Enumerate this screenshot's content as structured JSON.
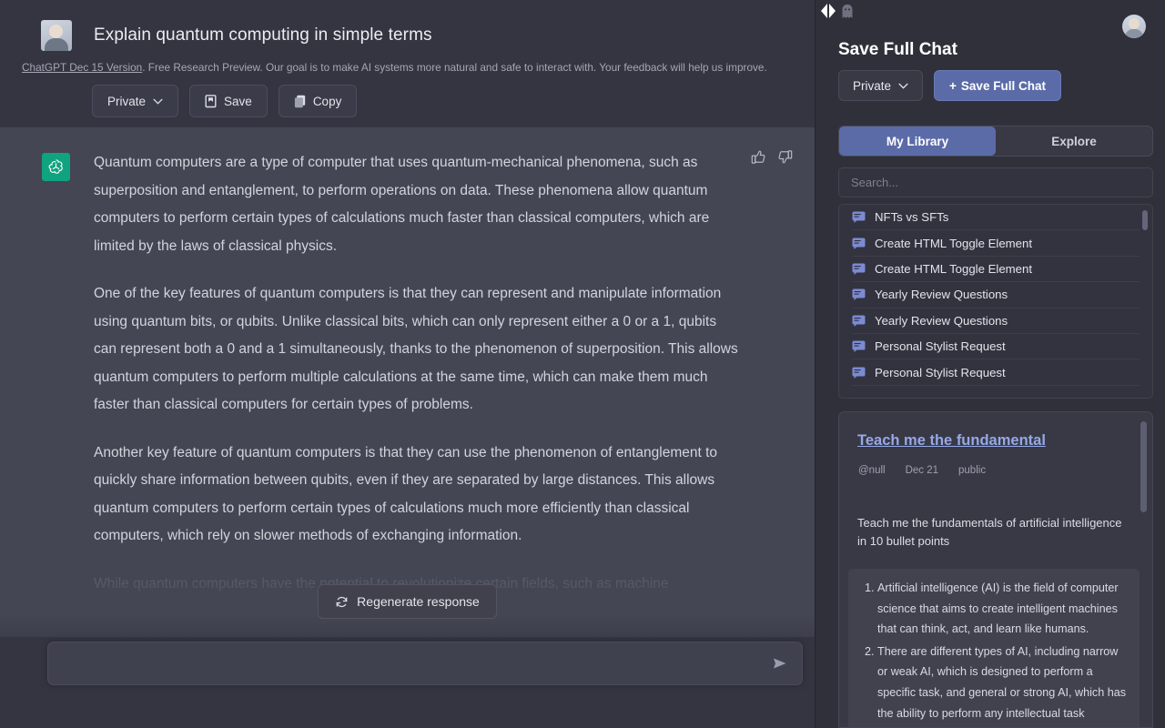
{
  "chat": {
    "prompt_title": "Explain quantum computing in simple terms",
    "actions": {
      "privacy_label": "Private",
      "save_label": "Save",
      "copy_label": "Copy"
    },
    "response_paragraphs": [
      "Quantum computers are a type of computer that uses quantum-mechanical phenomena, such as superposition and entanglement, to perform operations on data. These phenomena allow quantum computers to perform certain types of calculations much faster than classical computers, which are limited by the laws of classical physics.",
      "One of the key features of quantum computers is that they can represent and manipulate information using quantum bits, or qubits. Unlike classical bits, which can only represent either a 0 or a 1, qubits can represent both a 0 and a 1 simultaneously, thanks to the phenomenon of superposition. This allows quantum computers to perform multiple calculations at the same time, which can make them much faster than classical computers for certain types of problems.",
      "Another key feature of quantum computers is that they can use the phenomenon of entanglement to quickly share information between qubits, even if they are separated by large distances. This allows quantum computers to perform certain types of calculations much more efficiently than classical computers, which rely on slower methods of exchanging information.",
      "While quantum computers have the potential to revolutionize certain fields, such as machine"
    ],
    "regenerate_label": "Regenerate response",
    "composer_placeholder": "",
    "composer_value": "",
    "footer": {
      "version_link": "ChatGPT Dec 15 Version",
      "text": ". Free Research Preview. Our goal is to make AI systems more natural and safe to interact with. Your feedback will help us improve."
    }
  },
  "panel": {
    "title": "Save Full Chat",
    "privacy_label": "Private",
    "save_full_chat_label": "Save Full Chat",
    "save_plus": "+",
    "tabs": [
      {
        "label": "My Library",
        "active": true
      },
      {
        "label": "Explore",
        "active": false
      }
    ],
    "search": {
      "placeholder": "Search...",
      "value": ""
    },
    "library_items": [
      {
        "label": "NFTs vs SFTs"
      },
      {
        "label": "Create HTML Toggle Element"
      },
      {
        "label": "Create HTML Toggle Element"
      },
      {
        "label": "Yearly Review Questions"
      },
      {
        "label": "Yearly Review Questions"
      },
      {
        "label": "Personal Stylist Request"
      },
      {
        "label": "Personal Stylist Request"
      }
    ],
    "preview": {
      "title": "Teach me the fundamental",
      "author": "@null",
      "date": "Dec 21",
      "visibility": "public",
      "prompt": "Teach me the fundamentals of artificial intelligence in 10 bullet points",
      "answer_items": [
        "Artificial intelligence (AI) is the field of computer science that aims to create intelligent machines that can think, act, and learn like humans.",
        "There are different types of AI, including narrow or weak AI, which is designed to perform a specific task, and general or strong AI, which has the ability to perform any intellectual task"
      ]
    }
  },
  "colors": {
    "chat_bg": "#343541",
    "message_bg": "#444654",
    "panel_bg": "#2f303a",
    "accent": "#5b6ba8",
    "brand_green": "#10a37f",
    "link_blue": "#96a8e8"
  }
}
